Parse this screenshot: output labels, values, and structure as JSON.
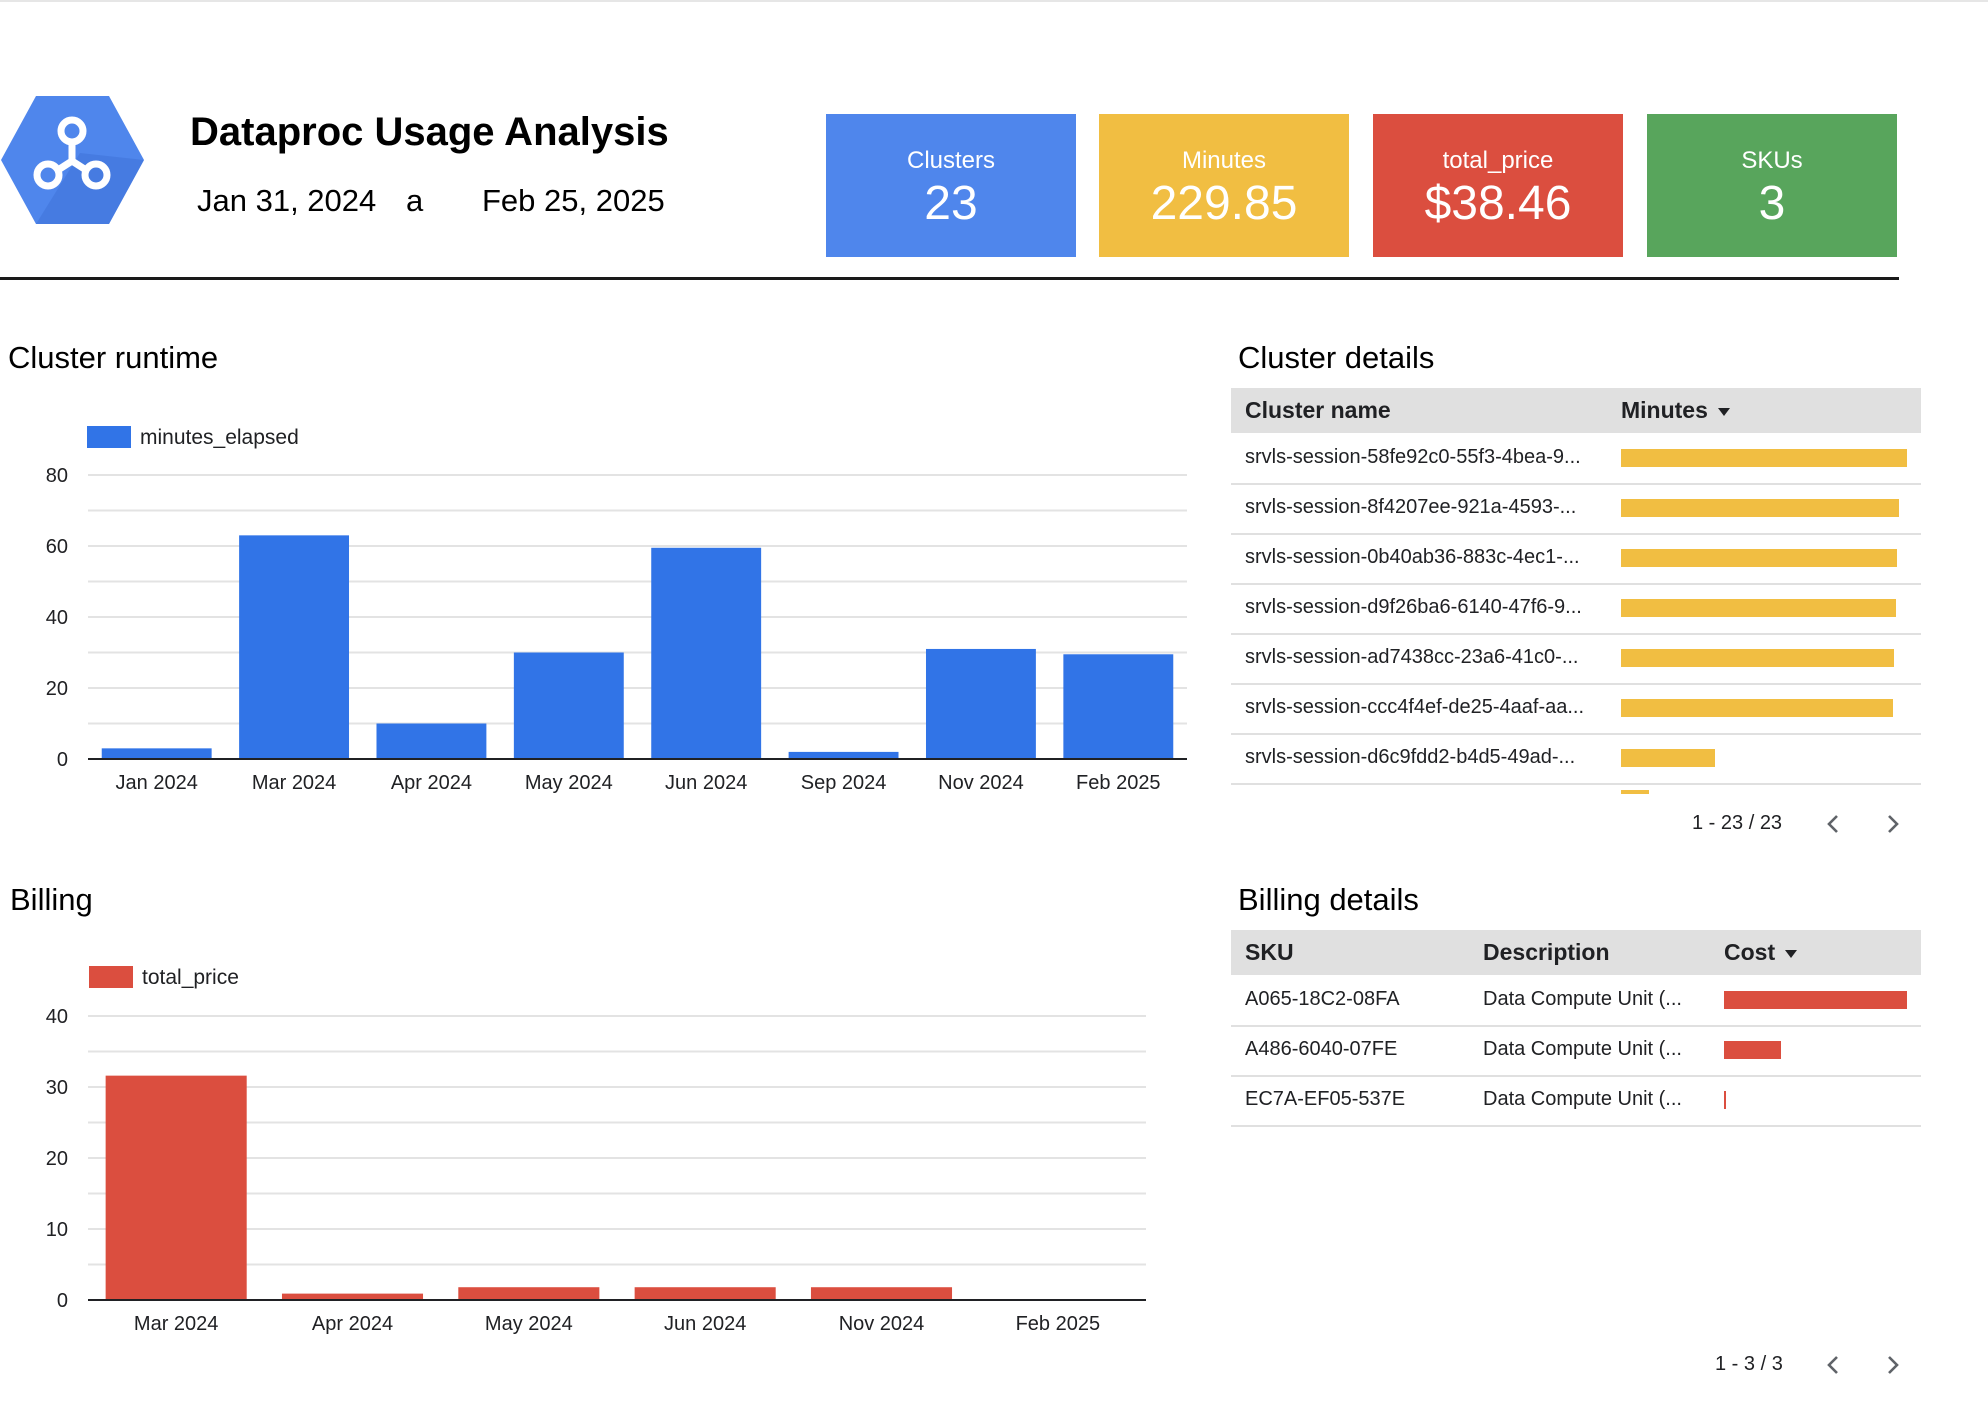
{
  "header": {
    "title": "Dataproc Usage Analysis",
    "date_start": "Jan 31, 2024",
    "date_separator": "a",
    "date_end": "Feb 25, 2025",
    "logo_icon": "dataproc-hexagon-icon"
  },
  "kpis": [
    {
      "label": "Clusters",
      "value": "23",
      "color": "#4f86ec"
    },
    {
      "label": "Minutes",
      "value": "229.85",
      "color": "#f1be42"
    },
    {
      "label": "total_price",
      "value": "$38.46",
      "color": "#db4e3f"
    },
    {
      "label": "SKUs",
      "value": "3",
      "color": "#58a55c"
    }
  ],
  "runtime": {
    "title": "Cluster runtime",
    "chart_data": {
      "type": "bar",
      "categories": [
        "Jan 2024",
        "Mar 2024",
        "Apr 2024",
        "May 2024",
        "Jun 2024",
        "Sep 2024",
        "Nov 2024",
        "Feb 2025"
      ],
      "series": [
        {
          "name": "minutes_elapsed",
          "values": [
            3,
            63,
            10,
            30,
            59.5,
            2,
            31,
            29.5
          ],
          "color": "#3174e7"
        }
      ],
      "yticks": [
        0,
        20,
        40,
        60,
        80
      ],
      "ylim": [
        0,
        80
      ],
      "grid": true,
      "legend": "top-left"
    }
  },
  "billing": {
    "title": "Billing",
    "chart_data": {
      "type": "bar",
      "categories": [
        "Mar 2024",
        "Apr 2024",
        "May 2024",
        "Jun 2024",
        "Nov 2024",
        "Feb 2025"
      ],
      "series": [
        {
          "name": "total_price",
          "values": [
            31.6,
            0.9,
            1.8,
            1.8,
            1.8,
            0
          ],
          "color": "#db4e3f"
        }
      ],
      "yticks": [
        0,
        10,
        20,
        30,
        40
      ],
      "ylim": [
        0,
        40
      ],
      "grid": true,
      "legend": "top-left"
    }
  },
  "cluster_details": {
    "title": "Cluster details",
    "col_name": "Cluster name",
    "col_minutes": "Minutes",
    "bar_color": "#f1be42",
    "rows": [
      {
        "name": "srvls-session-58fe92c0-55f3-4bea-9...",
        "fraction": 1.0
      },
      {
        "name": "srvls-session-8f4207ee-921a-4593-...",
        "fraction": 0.973
      },
      {
        "name": "srvls-session-0b40ab36-883c-4ec1-...",
        "fraction": 0.965
      },
      {
        "name": "srvls-session-d9f26ba6-6140-47f6-9...",
        "fraction": 0.96
      },
      {
        "name": "srvls-session-ad7438cc-23a6-41c0-...",
        "fraction": 0.956
      },
      {
        "name": "srvls-session-ccc4f4ef-de25-4aaf-aa...",
        "fraction": 0.951
      },
      {
        "name": "srvls-session-d6c9fdd2-b4d5-49ad-...",
        "fraction": 0.33
      }
    ],
    "pager": "1 - 23 / 23"
  },
  "billing_details": {
    "title": "Billing details",
    "col_sku": "SKU",
    "col_desc": "Description",
    "col_cost": "Cost",
    "bar_color": "#db4e3f",
    "rows": [
      {
        "sku": "A065-18C2-08FA",
        "desc": "Data Compute Unit (...",
        "fraction": 1.0
      },
      {
        "sku": "A486-6040-07FE",
        "desc": "Data Compute Unit (...",
        "fraction": 0.31
      },
      {
        "sku": "EC7A-EF05-537E",
        "desc": "Data Compute Unit (...",
        "fraction": 0.01
      }
    ],
    "pager": "1 - 3 / 3"
  }
}
